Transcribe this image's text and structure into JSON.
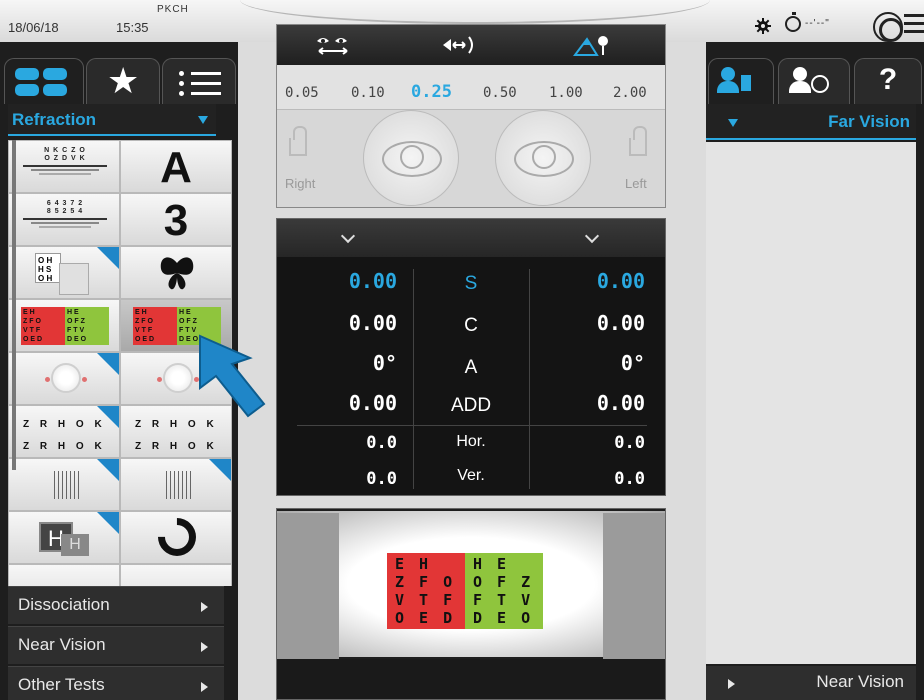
{
  "topbar": {
    "date": "18/06/18",
    "time": "15:35",
    "patient_code": "PKCH",
    "timer_text": "--'--\""
  },
  "left_panel": {
    "section": "Refraction",
    "accordion": [
      "Dissociation",
      "Near Vision",
      "Other Tests"
    ],
    "charts": {
      "letters_line1": "N K C Z O",
      "letters_line2": "O Z D V K",
      "numbers_line1": "6 4 3 7 2",
      "numbers_line2": "8 5 2 5 4",
      "big_a": "A",
      "big_3": "3",
      "oh_hs": "O H\nH S\nO H",
      "zr_row": "Z R H O K",
      "h_letter": "H"
    }
  },
  "occluder": {
    "visual_acuities": [
      "0.05",
      "0.10",
      "0.25",
      "0.50",
      "1.00",
      "2.00"
    ],
    "selected_acuity": "0.25",
    "right_label": "Right",
    "left_label": "Left"
  },
  "refraction": {
    "rows": [
      {
        "label": "S",
        "right": "0.00",
        "left": "0.00",
        "highlight": true
      },
      {
        "label": "C",
        "right": "0.00",
        "left": "0.00",
        "highlight": false
      },
      {
        "label": "A",
        "right": "0°",
        "left": "0°",
        "highlight": false
      },
      {
        "label": "ADD",
        "right": "0.00",
        "left": "0.00",
        "highlight": false
      },
      {
        "label": "Hor.",
        "right": "0.0",
        "left": "0.0",
        "highlight": false
      },
      {
        "label": "Ver.",
        "right": "0.0",
        "left": "0.0",
        "highlight": false
      }
    ]
  },
  "chart_view": {
    "red_rows": [
      "E  H",
      "Z F O",
      "V T F",
      "O E D"
    ],
    "green_rows": [
      "H  E",
      "O F Z",
      "F T V",
      "D E O"
    ]
  },
  "right_panel": {
    "header": "Far Vision",
    "footer": "Near Vision",
    "help_glyph": "?"
  },
  "colors": {
    "accent": "#2aa8e0",
    "red": "#e23636",
    "green": "#8fc53d",
    "dark_panel": "#1e1e1e"
  },
  "icons": [
    "gear-icon",
    "stopwatch-icon",
    "target-icon",
    "menu-icon",
    "grid-view-icon",
    "star-icon",
    "list-icon",
    "binocular-eyes-icon",
    "prism-icon",
    "mountain-flower-icon",
    "patient-file-icon",
    "history-icon",
    "help-icon",
    "lock-icon",
    "eye-icon",
    "pointer-arrow-icon"
  ]
}
